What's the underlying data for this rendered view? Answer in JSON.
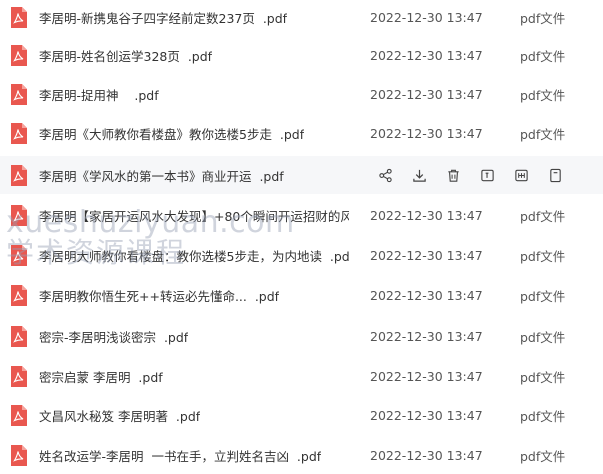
{
  "files": [
    {
      "name": "李居明-新携鬼谷子四字经前定数237页  .pdf",
      "date": "2022-12-30 13:47",
      "type": "pdf文件"
    },
    {
      "name": "李居明-姓名创运学328页  .pdf",
      "date": "2022-12-30 13:47",
      "type": "pdf文件"
    },
    {
      "name": "李居明-捉用神    .pdf",
      "date": "2022-12-30 13:47",
      "type": "pdf文件"
    },
    {
      "name": "李居明《大师教你看楼盘》教你选楼5步走  .pdf",
      "date": "2022-12-30 13:47",
      "type": "pdf文件"
    },
    {
      "name": "李居明《学风水的第一本书》商业开运  .pdf",
      "date": "",
      "type": ""
    },
    {
      "name": "李居明【家居开运风水大发现】+80个瞬间开运招财的风...",
      "date": "2022-12-30 13:47",
      "type": "pdf文件"
    },
    {
      "name": "李居明大师教你看楼盘：教你选楼5步走，为内地读  .pdf",
      "date": "2022-12-30 13:47",
      "type": "pdf文件"
    },
    {
      "name": "李居明教你悟生死++转运必先懂命...  .pdf",
      "date": "2022-12-30 13:47",
      "type": "pdf文件"
    },
    {
      "name": "密宗-李居明浅谈密宗  .pdf",
      "date": "2022-12-30 13:47",
      "type": "pdf文件"
    },
    {
      "name": "密宗启蒙 李居明  .pdf",
      "date": "2022-12-30 13:47",
      "type": "pdf文件"
    },
    {
      "name": "文昌风水秘笈 李居明著  .pdf",
      "date": "2022-12-30 13:47",
      "type": "pdf文件"
    },
    {
      "name": "姓名改运学-李居明  一书在手，立判姓名吉凶  .pdf",
      "date": "2022-12-30 13:47",
      "type": "pdf文件"
    }
  ],
  "hovered_row_actions": [
    "share-icon",
    "download-icon",
    "delete-icon",
    "rename-icon",
    "copy-icon",
    "more-icon"
  ],
  "watermark": {
    "line1": "xueshuziyuan.com",
    "line2": "学术资源课程"
  },
  "colors": {
    "pdf_icon": "#e9574f",
    "hover_bg": "#f6f7f9",
    "text": "#333333",
    "muted": "#555555",
    "watermark": "#96a0b4"
  }
}
